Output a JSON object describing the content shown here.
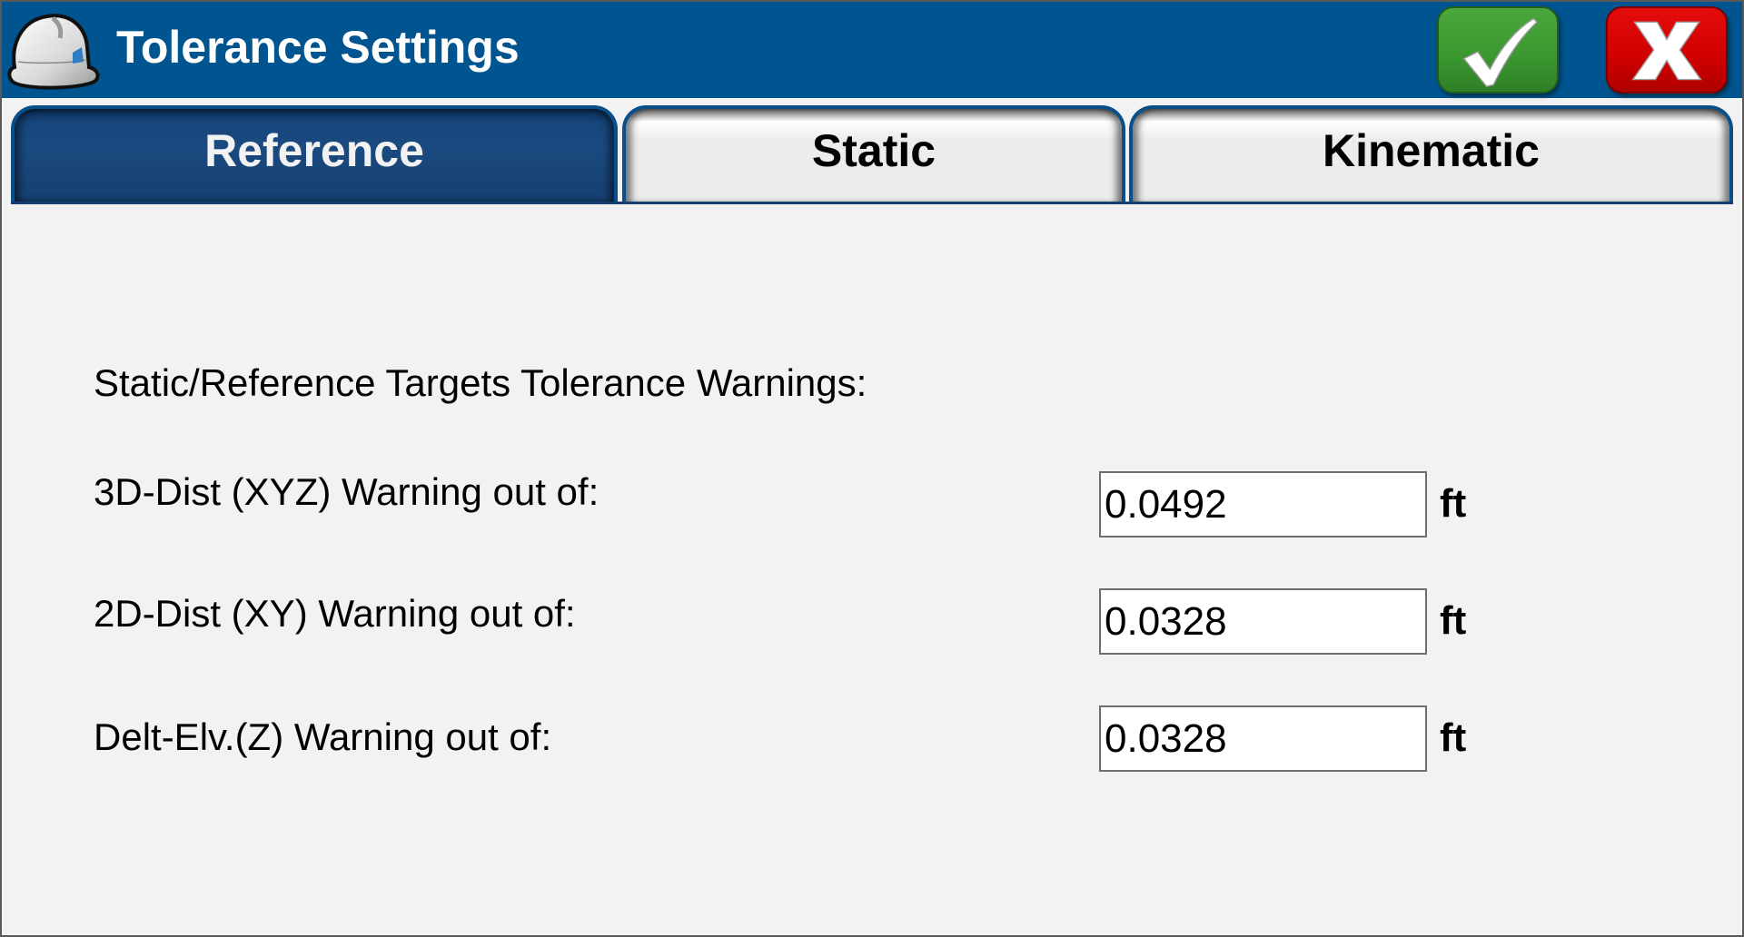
{
  "window": {
    "title": "Tolerance Settings",
    "app_icon": "hard-hat-icon"
  },
  "header_buttons": {
    "ok": {
      "icon": "checkmark-icon",
      "label": "OK",
      "color": "#3a962f"
    },
    "cancel": {
      "icon": "x-icon",
      "label": "Cancel",
      "color": "#cf0000"
    }
  },
  "tabs": [
    {
      "label": "Reference",
      "active": true
    },
    {
      "label": "Static",
      "active": false
    },
    {
      "label": "Kinematic",
      "active": false
    }
  ],
  "section": {
    "heading": "Static/Reference Targets Tolerance Warnings:"
  },
  "rows": [
    {
      "label": "3D-Dist (XYZ) Warning out of:",
      "value": "0.0492",
      "unit": "ft"
    },
    {
      "label": "2D-Dist (XY) Warning out of:",
      "value": "0.0328",
      "unit": "ft"
    },
    {
      "label": "Delt-Elv.(Z) Warning out of:",
      "value": "0.0328",
      "unit": "ft"
    }
  ],
  "colors": {
    "header_bg": "#00548f",
    "active_tab_bg": "#1a4a80",
    "inactive_tab_bg": "#ececec",
    "content_bg": "#f2f2f2"
  }
}
